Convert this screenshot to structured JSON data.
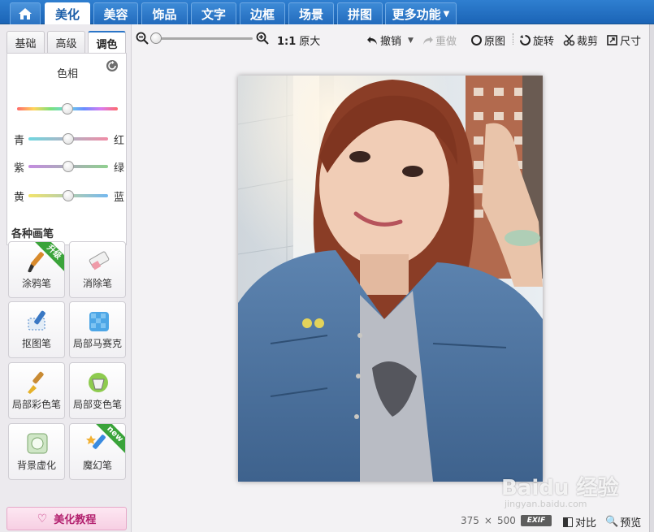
{
  "menu": {
    "tabs": [
      {
        "label": "美化"
      },
      {
        "label": "美容"
      },
      {
        "label": "饰品"
      },
      {
        "label": "文字"
      },
      {
        "label": "边框"
      },
      {
        "label": "场景"
      },
      {
        "label": "拼图"
      },
      {
        "label": "更多功能"
      }
    ],
    "active_tab": "美化",
    "home_icon": "home-icon"
  },
  "sub_tabs": [
    {
      "label": "基础"
    },
    {
      "label": "高级"
    },
    {
      "label": "调色"
    }
  ],
  "adjust": {
    "hue_label": "色相",
    "hue_value": 0.5,
    "rows": [
      {
        "left": "青",
        "right": "红",
        "value": 0.5
      },
      {
        "left": "紫",
        "right": "绿",
        "value": 0.5
      },
      {
        "left": "黄",
        "right": "蓝",
        "value": 0.5
      }
    ]
  },
  "brushes": {
    "title": "各种画笔",
    "items": [
      {
        "label": "涂鸦笔",
        "badge": "升级"
      },
      {
        "label": "消除笔",
        "badge": ""
      },
      {
        "label": "抠图笔",
        "badge": ""
      },
      {
        "label": "局部马赛克",
        "badge": ""
      },
      {
        "label": "局部彩色笔",
        "badge": ""
      },
      {
        "label": "局部变色笔",
        "badge": ""
      },
      {
        "label": "背景虚化",
        "badge": ""
      },
      {
        "label": "魔幻笔",
        "badge": "new"
      }
    ]
  },
  "tutorial_label": "美化教程",
  "toolbar": {
    "zoom_level": 0.0,
    "ratio_bold": "1:1",
    "ratio_text": "原大",
    "undo": "撤销",
    "redo": "重做",
    "original": "原图",
    "rotate": "旋转",
    "crop": "裁剪",
    "size": "尺寸"
  },
  "status": {
    "width": "375",
    "times": "×",
    "height": "500",
    "exif": "EXIF",
    "compare": "对比",
    "preview": "预览"
  },
  "watermark": {
    "line1": "Baidu 经验",
    "line2": "jingyan.baidu.com"
  },
  "colors": {
    "menu_blue": "#1b64b6",
    "active_tab_text": "#1b5ea8",
    "badge_green": "#3aa33a",
    "tutorial_pink": "#b3206e"
  }
}
